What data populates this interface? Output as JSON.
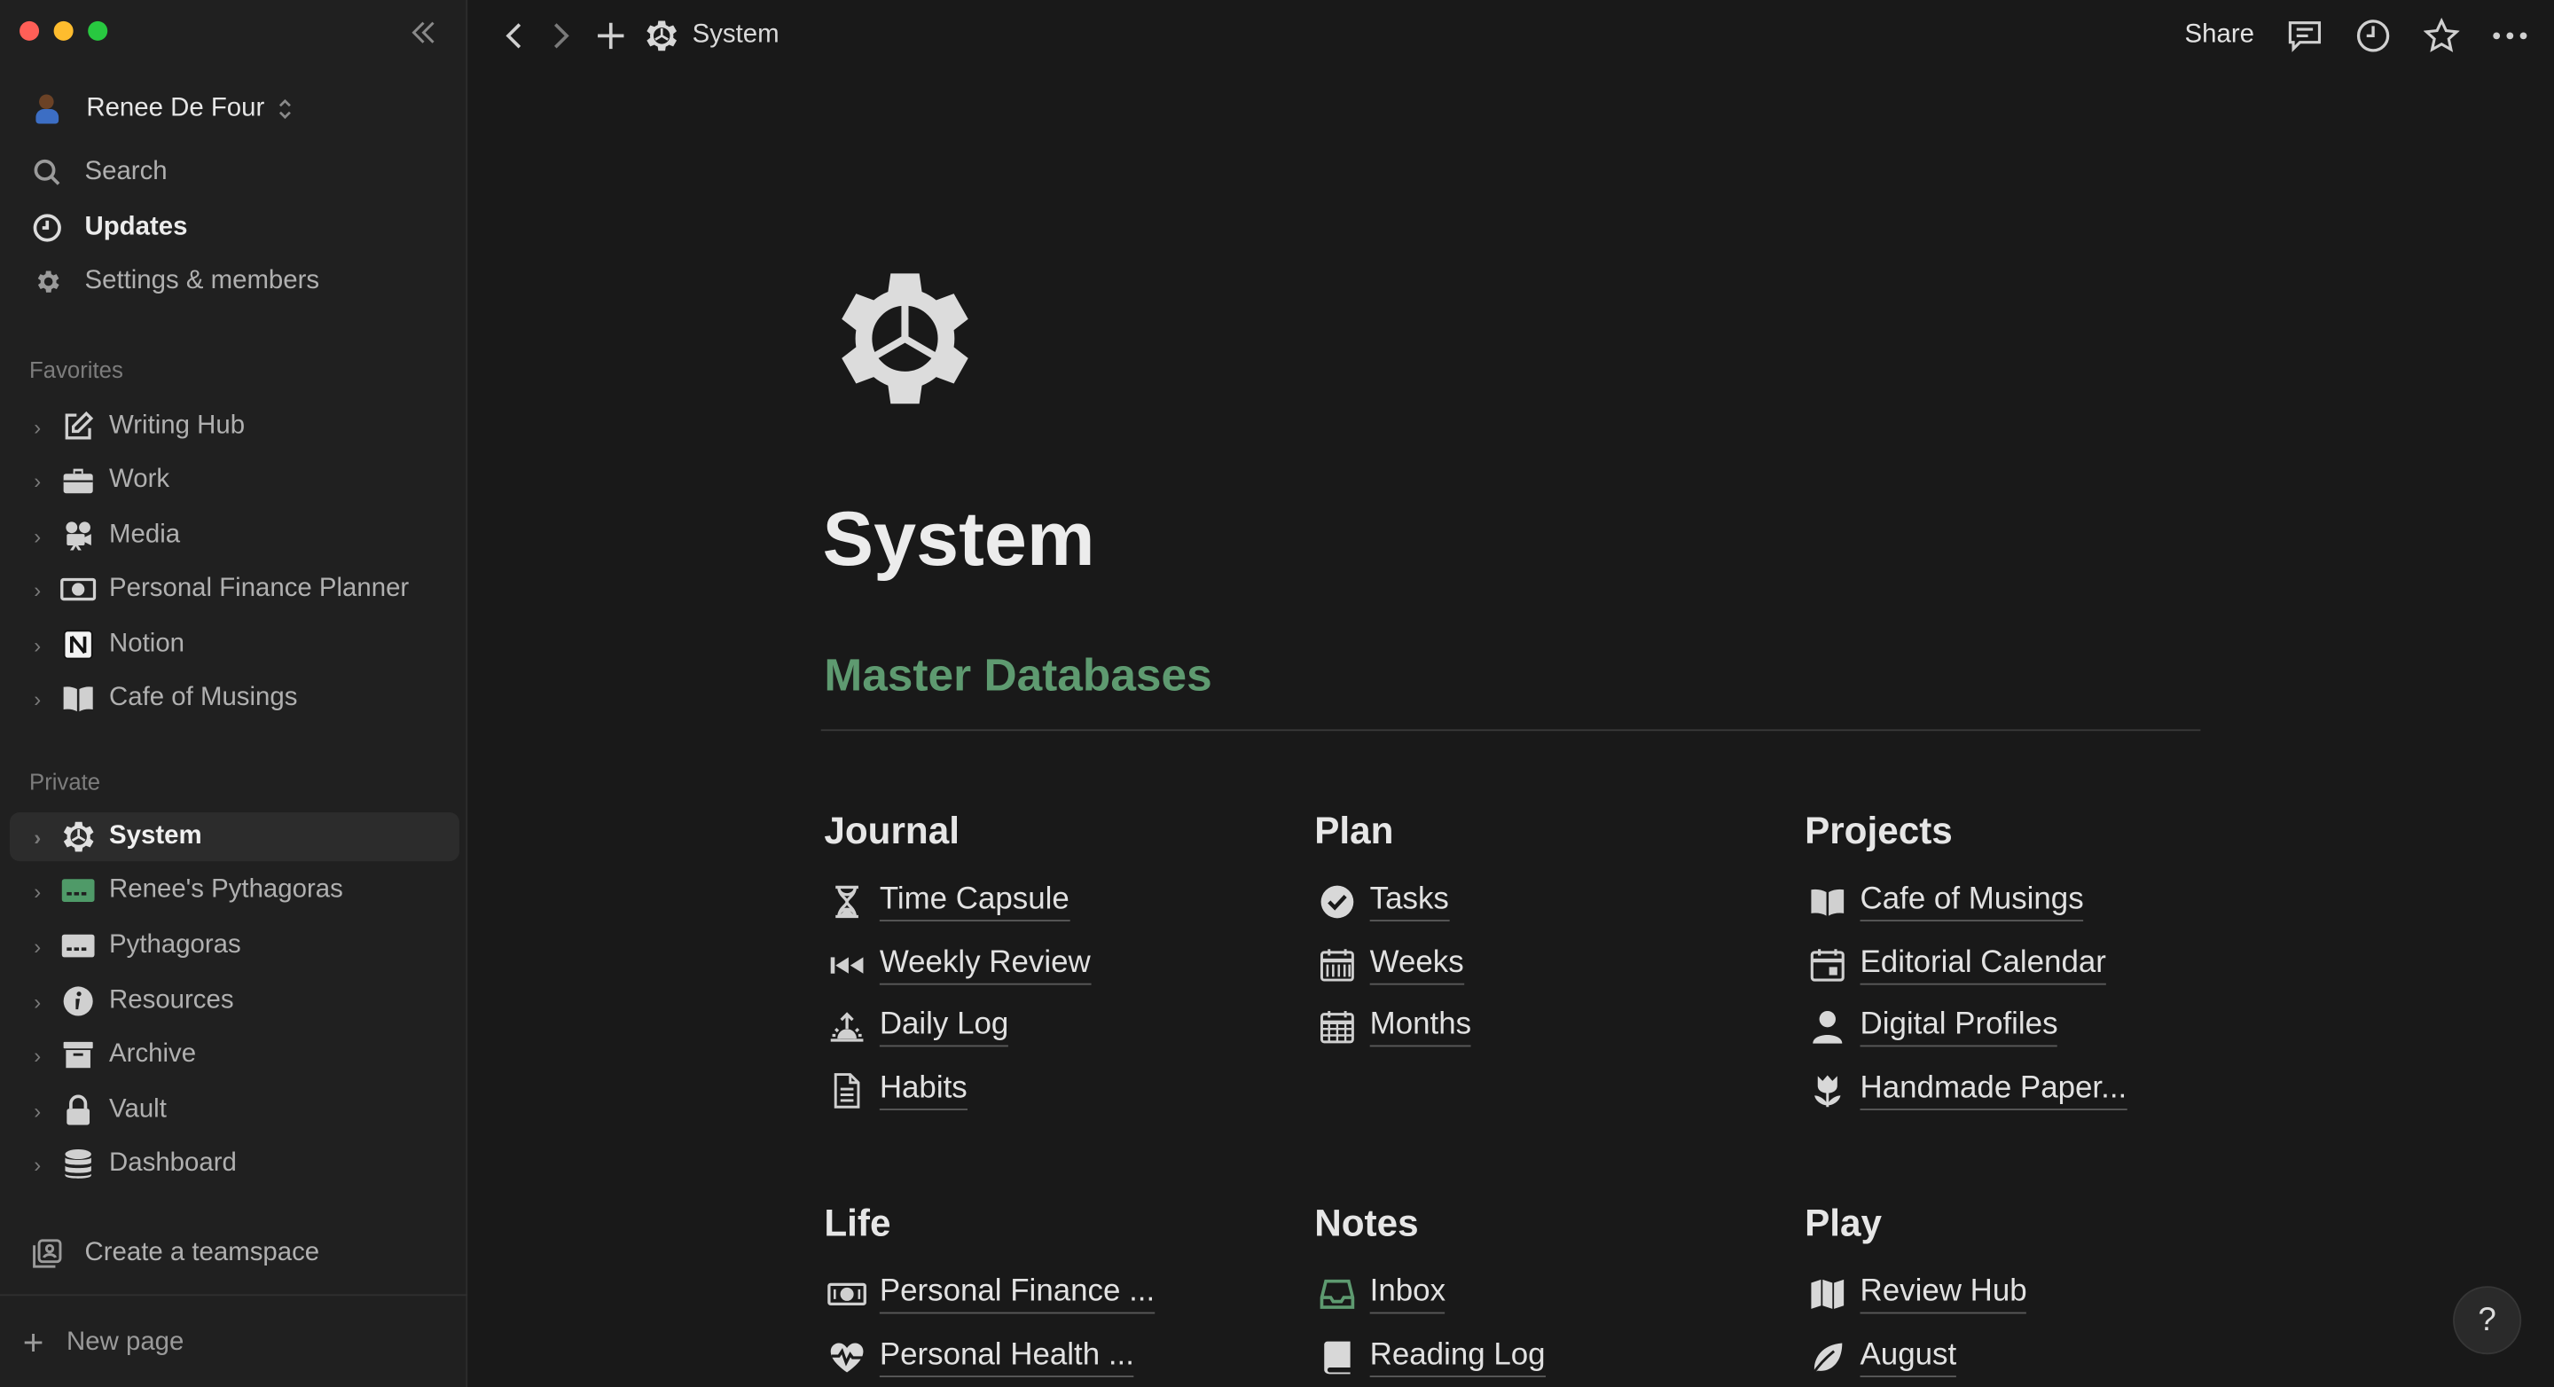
{
  "window": {
    "traffic_lights": [
      "#ff5f57",
      "#febc2e",
      "#28c840"
    ]
  },
  "sidebar": {
    "workspace_name": "Renee De Four",
    "top_items": [
      {
        "label": "Search",
        "icon": "search-icon"
      },
      {
        "label": "Updates",
        "icon": "clock-icon"
      },
      {
        "label": "Settings & members",
        "icon": "gear-icon"
      }
    ],
    "favorites_label": "Favorites",
    "favorites": [
      {
        "label": "Writing Hub",
        "icon": "edit-icon"
      },
      {
        "label": "Work",
        "icon": "briefcase-icon"
      },
      {
        "label": "Media",
        "icon": "camera-icon"
      },
      {
        "label": "Personal Finance Planner",
        "icon": "banknote-icon"
      },
      {
        "label": "Notion",
        "icon": "notion-icon"
      },
      {
        "label": "Cafe of Musings",
        "icon": "book-icon"
      }
    ],
    "private_label": "Private",
    "private": [
      {
        "label": "System",
        "icon": "gear-icon",
        "active": true
      },
      {
        "label": "Renee's Pythagoras",
        "icon": "card-green-icon"
      },
      {
        "label": "Pythagoras",
        "icon": "card-icon"
      },
      {
        "label": "Resources",
        "icon": "info-icon"
      },
      {
        "label": "Archive",
        "icon": "archive-icon"
      },
      {
        "label": "Vault",
        "icon": "lock-icon"
      },
      {
        "label": "Dashboard",
        "icon": "database-icon"
      }
    ],
    "create_teamspace": "Create a teamspace",
    "new_page": "New page"
  },
  "topbar": {
    "breadcrumb": "System",
    "share_label": "Share"
  },
  "page": {
    "title": "System",
    "section_heading": "Master Databases",
    "accent_color": "#5e9a70",
    "columns_row1": [
      {
        "heading": "Journal",
        "links": [
          {
            "label": "Time Capsule",
            "icon": "hourglass-icon"
          },
          {
            "label": "Weekly Review",
            "icon": "rewind-icon"
          },
          {
            "label": "Daily Log",
            "icon": "sunrise-icon"
          },
          {
            "label": "Habits",
            "icon": "document-icon"
          }
        ]
      },
      {
        "heading": "Plan",
        "links": [
          {
            "label": "Tasks",
            "icon": "checkmark-circle-icon"
          },
          {
            "label": "Weeks",
            "icon": "calendar-week-icon"
          },
          {
            "label": "Months",
            "icon": "calendar-month-icon"
          }
        ]
      },
      {
        "heading": "Projects",
        "links": [
          {
            "label": "Cafe of Musings",
            "icon": "book-icon"
          },
          {
            "label": "Editorial Calendar",
            "icon": "calendar-day-icon"
          },
          {
            "label": "Digital Profiles",
            "icon": "person-icon"
          },
          {
            "label": "Handmade Paper...",
            "icon": "tulip-icon"
          }
        ]
      }
    ],
    "columns_row2": [
      {
        "heading": "Life",
        "links": [
          {
            "label": "Personal Finance ...",
            "icon": "banknote-icon"
          },
          {
            "label": "Personal Health ...",
            "icon": "heartbeat-icon"
          }
        ]
      },
      {
        "heading": "Notes",
        "links": [
          {
            "label": "Inbox",
            "icon": "inbox-icon"
          },
          {
            "label": "Reading Log",
            "icon": "book-closed-icon"
          }
        ]
      },
      {
        "heading": "Play",
        "links": [
          {
            "label": "Review Hub",
            "icon": "map-icon"
          },
          {
            "label": "August",
            "icon": "leaf-icon"
          }
        ]
      }
    ],
    "help_label": "?"
  }
}
